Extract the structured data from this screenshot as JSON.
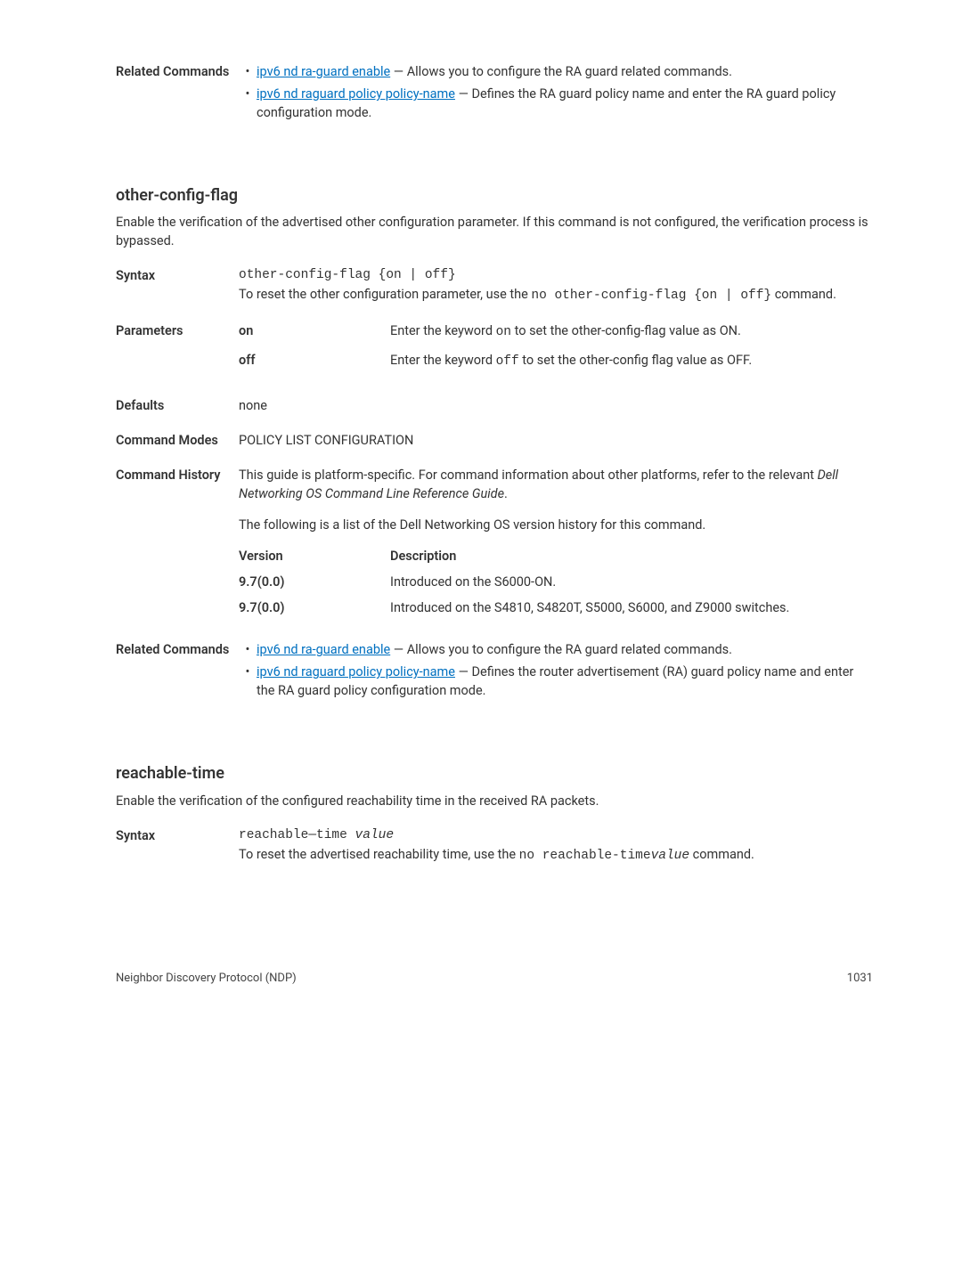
{
  "top": {
    "related_label": "Related Commands",
    "bullet1_link": "ipv6 nd ra-guard enable",
    "bullet1_rest": " — Allows you to configure the RA guard related commands.",
    "bullet2_link": "ipv6 nd raguard policy policy-name",
    "bullet2_rest": " — Defines the RA guard policy name and enter the RA guard policy configuration mode."
  },
  "section1": {
    "heading": "other-config-flag",
    "desc": "Enable the verification of the advertised other configuration parameter. If this command is not configured, the verification process is bypassed.",
    "syntax_label": "Syntax",
    "syntax_cmd": "other-config-flag {on | off}",
    "syntax_reset_pre": "To reset the other configuration parameter, use the ",
    "syntax_reset_mono": "no other-config-flag {on | off}",
    "syntax_reset_post": " command.",
    "params_label": "Parameters",
    "param_on_name": "on",
    "param_on_pre": "Enter the keyword ",
    "param_on_mono": "on",
    "param_on_post": " to set the other-config-flag value as ON.",
    "param_off_name": "off",
    "param_off_pre": "Enter the keyword ",
    "param_off_mono": "off",
    "param_off_post": " to set the other-config flag value as OFF.",
    "defaults_label": "Defaults",
    "defaults_val": "none",
    "modes_label": "Command Modes",
    "modes_val": "POLICY LIST CONFIGURATION",
    "history_label": "Command History",
    "history_p1_pre": "This guide is platform-specific. For command information about other platforms, refer to the relevant ",
    "history_p1_em": "Dell Networking OS Command Line Reference Guide",
    "history_p1_post": ".",
    "history_p2": "The following is a list of the Dell Networking OS version history for this command.",
    "ver_h1": "Version",
    "ver_h2": "Description",
    "ver_r1c1": "9.7(0.0)",
    "ver_r1c2": "Introduced on the S6000-ON.",
    "ver_r2c1": "9.7(0.0)",
    "ver_r2c2": "Introduced on the S4810, S4820T, S5000, S6000, and Z9000 switches.",
    "related_label": "Related Commands",
    "bullet1_link": "ipv6 nd ra-guard enable",
    "bullet1_rest": " — Allows you to configure the RA guard related commands.",
    "bullet2_link": "ipv6 nd raguard policy policy-name",
    "bullet2_rest": " — Defines the router advertisement (RA) guard policy name and enter the RA guard policy configuration mode."
  },
  "section2": {
    "heading": "reachable-time",
    "desc": "Enable the verification of the configured reachability time in the received RA packets.",
    "syntax_label": "Syntax",
    "syntax_cmd_pre": "reachable—time ",
    "syntax_cmd_em": "value",
    "syntax_reset_pre": "To reset the advertised reachability time, use the ",
    "syntax_reset_mono": "no reachable-time",
    "syntax_reset_em": "value",
    "syntax_reset_post": " command."
  },
  "footer": {
    "left": "Neighbor Discovery Protocol (NDP)",
    "right": "1031"
  }
}
